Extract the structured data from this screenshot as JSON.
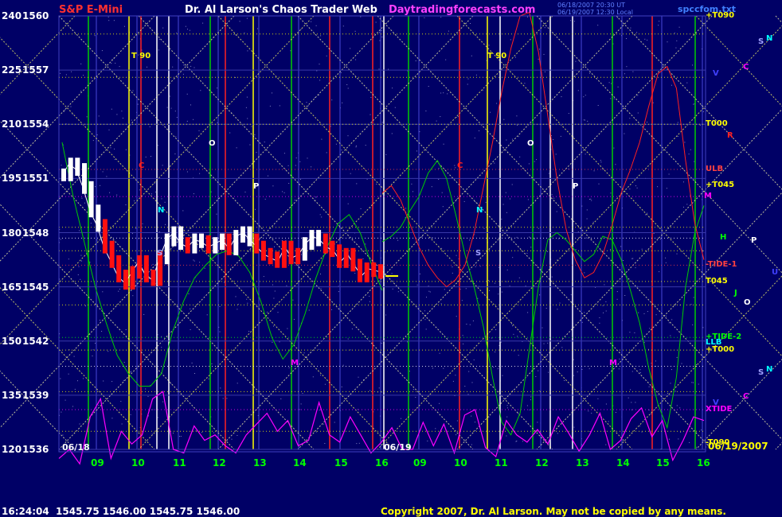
{
  "header": {
    "instrument": "S&P E-Mini",
    "title": "Dr. Al Larson's Chaos Trader Web",
    "site": "Daytradingforecasts.com",
    "timestamp_1": "06/18/2007 20:30 UT",
    "timestamp_2": "06/19/2007 12:30 Local",
    "filename": "spccfom.txt"
  },
  "footer": {
    "quote": "16:24:04  1545.75 1546.00 1545.75 1546.00",
    "copyright": "Copyright 2007, Dr. Al Larson. May not be copied by any means."
  },
  "chart_data": {
    "type": "line",
    "y_axis_left": {
      "ticks": [
        {
          "osc": "240",
          "price": "1560"
        },
        {
          "osc": "225",
          "price": "1557"
        },
        {
          "osc": "210",
          "price": "1554"
        },
        {
          "osc": "195",
          "price": "1551"
        },
        {
          "osc": "180",
          "price": "1548"
        },
        {
          "osc": "165",
          "price": "1545"
        },
        {
          "osc": "150",
          "price": "1542"
        },
        {
          "osc": "135",
          "price": "1539"
        },
        {
          "osc": "120",
          "price": "1536"
        }
      ],
      "ylim": [
        1536,
        1560
      ]
    },
    "x_axis": {
      "sessions": [
        "06/18",
        "06/19"
      ],
      "end_date": "06/19/2007",
      "hour_ticks": [
        "09",
        "10",
        "11",
        "12",
        "13",
        "14",
        "15",
        "16",
        "09",
        "10",
        "11",
        "12",
        "13",
        "14",
        "15",
        "16"
      ]
    },
    "right_labels": [
      {
        "text": "+T090",
        "price": 1560.0,
        "color": "#ffff00"
      },
      {
        "text": "T000",
        "price": 1554.0,
        "color": "#ffff00"
      },
      {
        "text": "ULB",
        "price": 1551.5,
        "color": "#ff4040"
      },
      {
        "text": "+T045",
        "price": 1550.6,
        "color": "#ffff00"
      },
      {
        "text": "M",
        "price": 1550.0,
        "color": "#ff00ff"
      },
      {
        "text": "-TIDE-1",
        "price": 1546.2,
        "color": "#ff4040"
      },
      {
        "text": "T045",
        "price": 1545.3,
        "color": "#ffff00"
      },
      {
        "text": "+TIDE-2",
        "price": 1542.2,
        "color": "#00ff00"
      },
      {
        "text": "LLB",
        "price": 1541.9,
        "color": "#00ffff"
      },
      {
        "text": "+T000",
        "price": 1541.5,
        "color": "#ffff00"
      },
      {
        "text": "XTIDE",
        "price": 1538.2,
        "color": "#ff00ff"
      },
      {
        "text": "-T090",
        "price": 1536.2,
        "color": "#ffff00"
      }
    ],
    "planet_glyphs": [
      {
        "text": "S",
        "color": "#a0a0ff"
      },
      {
        "text": "N",
        "color": "#00ffff"
      },
      {
        "text": "C",
        "color": "#ff00ff"
      },
      {
        "text": "V",
        "color": "#4040ff"
      },
      {
        "text": "R",
        "color": "#ff2020"
      },
      {
        "text": "H",
        "color": "#00ff00"
      },
      {
        "text": "P",
        "color": "#ffffff"
      },
      {
        "text": "U",
        "color": "#4040ff"
      },
      {
        "text": "J",
        "color": "#00ff00"
      },
      {
        "text": "O",
        "color": "#ffffff"
      },
      {
        "text": "S",
        "color": "#a0a0ff"
      },
      {
        "text": "N",
        "color": "#00ffff"
      },
      {
        "text": "C",
        "color": "#ff00ff"
      },
      {
        "text": "V",
        "color": "#4040ff"
      }
    ],
    "chart_annotations": [
      {
        "text": "T 90",
        "color": "#ffff00"
      },
      {
        "text": "T 90",
        "color": "#ffff00"
      },
      {
        "text": "O",
        "color": "#ffffff"
      },
      {
        "text": "O",
        "color": "#ffffff"
      },
      {
        "text": "P",
        "color": "#ffffff"
      },
      {
        "text": "P",
        "color": "#ffffff"
      },
      {
        "text": "C",
        "color": "#ff2020"
      },
      {
        "text": "C",
        "color": "#ff2020"
      },
      {
        "text": "N",
        "color": "#00ffff"
      },
      {
        "text": "N",
        "color": "#00ffff"
      },
      {
        "text": "S",
        "color": "#a0a0ff"
      },
      {
        "text": "S",
        "color": "#a0a0ff"
      },
      {
        "text": "M",
        "color": "#ff00ff"
      },
      {
        "text": "M",
        "color": "#ff00ff"
      }
    ],
    "colors": {
      "background": "#000066",
      "grid_yellow": "#ffff00",
      "green_flux": "#00cc00",
      "red_flux": "#ff2020",
      "magenta_osc": "#ff00ff",
      "price_bars": "#ffffff",
      "price_lower": "#ff0000"
    },
    "series": [
      {
        "values": [
          1551.2,
          1551.8,
          1551.5,
          1550.5,
          1549.2,
          1548.4,
          1547.2,
          1546.4,
          1545.6,
          1545.2,
          1545.8,
          1546.4,
          1545.6,
          1545.4,
          1546.6,
          1547.6,
          1548.0,
          1547.4,
          1547.2,
          1547.6,
          1547.5,
          1547.2,
          1547.4,
          1547.6,
          1547.1,
          1547.8,
          1548.0,
          1547.6,
          1547.2,
          1546.8,
          1546.6,
          1546.4,
          1547.2,
          1546.6,
          1546.8,
          1547.4,
          1547.8,
          1547.6,
          1547.2,
          1547.0,
          1546.4,
          1546.8,
          1546.2,
          1545.6,
          1546.0,
          1545.9,
          1545.8
        ]
      },
      {
        "values": [
          1553.0,
          1550.0,
          1547.5,
          1545.0,
          1543.0,
          1541.2,
          1540.2,
          1539.5,
          1539.5,
          1540.2,
          1542.5,
          1544.2,
          1545.5,
          1546.2,
          1546.8,
          1547.0,
          1546.7,
          1545.8,
          1544.2,
          1542.2,
          1541.0,
          1541.8,
          1543.5,
          1545.5,
          1547.2,
          1548.5,
          1549.0,
          1548.0,
          1546.3,
          1544.8
        ]
      },
      {
        "values": [
          1547.5,
          1547.8,
          1548.3,
          1549.2,
          1550.0,
          1551.3,
          1552.0,
          1551.0,
          1549.0,
          1546.8,
          1545.0,
          1542.8,
          1540.0,
          1537.5,
          1536.8,
          1538.0,
          1541.5,
          1545.0,
          1547.6,
          1548.0,
          1547.6,
          1547.0,
          1546.4,
          1546.8,
          1547.8,
          1547.6,
          1546.5,
          1544.8,
          1543.0,
          1540.5,
          1538.5,
          1537.2,
          1540.0,
          1545.0,
          1548.0,
          1549.5
        ]
      },
      {
        "values": [
          1550.2,
          1550.6,
          1549.8,
          1548.5,
          1547.2,
          1546.2,
          1545.5,
          1545.0,
          1545.4,
          1546.2,
          1548.0,
          1550.5,
          1553.0,
          1555.8,
          1558.2,
          1560.0,
          1560.2,
          1558.0,
          1554.5,
          1551.0,
          1548.2,
          1546.5,
          1545.5,
          1545.8,
          1546.8,
          1548.4,
          1550.2,
          1551.5,
          1553.0,
          1555.0,
          1556.8,
          1557.2,
          1556.0,
          1552.0,
          1548.5,
          1546.5
        ]
      },
      {
        "values": [
          1535.5,
          1536.0,
          1535.2,
          1537.8,
          1538.8,
          1535.5,
          1537.0,
          1536.3,
          1536.8,
          1538.8,
          1539.2,
          1536.0,
          1535.8,
          1537.3,
          1536.5,
          1536.8,
          1536.2,
          1535.8,
          1536.8,
          1537.4,
          1538.0,
          1537.0,
          1537.6,
          1536.2,
          1536.5,
          1538.6,
          1536.8,
          1536.4,
          1537.8,
          1536.8,
          1535.8,
          1536.4,
          1537.2,
          1536.0,
          1536.0,
          1537.5,
          1536.2,
          1537.4,
          1535.8,
          1537.9,
          1538.2,
          1536.1,
          1535.6,
          1537.6,
          1536.8,
          1536.4,
          1537.1,
          1536.3,
          1537.8,
          1536.9,
          1535.9,
          1536.8,
          1538.0,
          1536.0,
          1536.5,
          1537.7,
          1538.3,
          1536.7,
          1537.6,
          1535.4,
          1536.5,
          1537.8,
          1537.6
        ]
      }
    ]
  }
}
